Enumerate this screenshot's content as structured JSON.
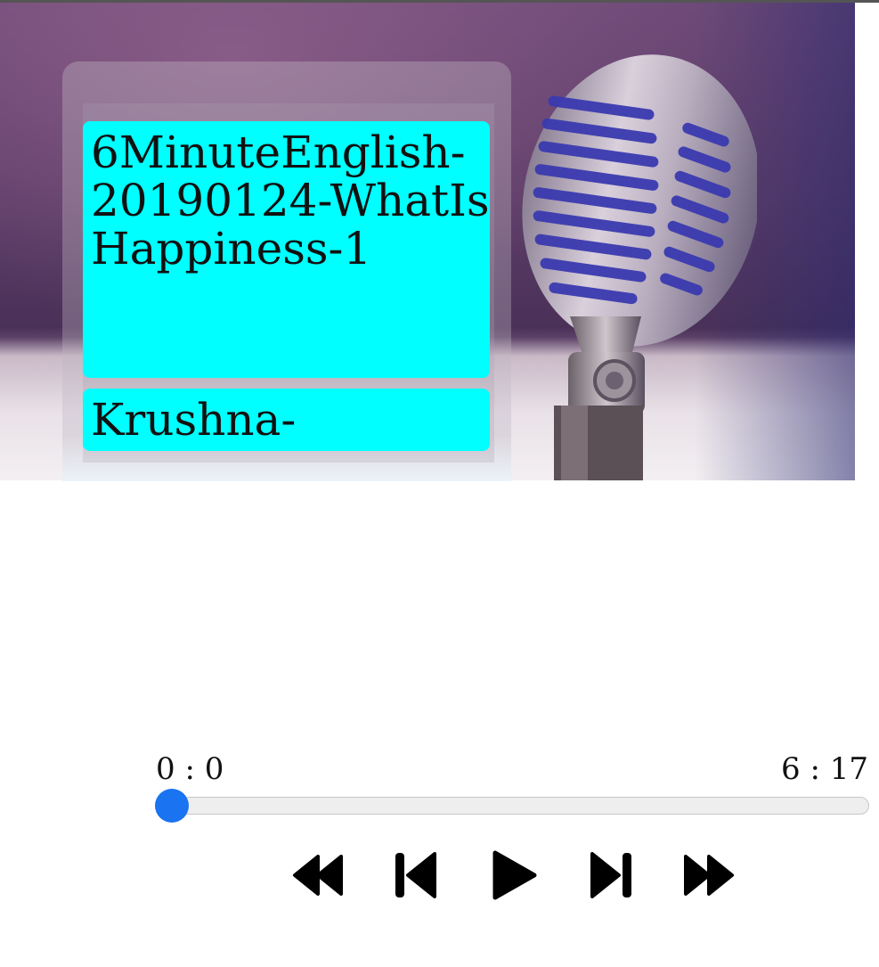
{
  "playlist": {
    "tracks": [
      {
        "title": "6MinuteEnglish-20190124-WhatIsHappiness-1"
      },
      {
        "title": "Krushna-"
      }
    ]
  },
  "player": {
    "current_time": "0 : 0",
    "total_time": "6 : 17",
    "progress_fraction": 0.0,
    "accent_color": "#1a73f0"
  },
  "controls": {
    "icons": [
      "rewind-icon",
      "skip-previous-icon",
      "play-icon",
      "skip-next-icon",
      "fast-forward-icon"
    ]
  },
  "hero": {
    "image": "vintage-microphone"
  },
  "colors": {
    "track_bg": "#00ffff"
  }
}
